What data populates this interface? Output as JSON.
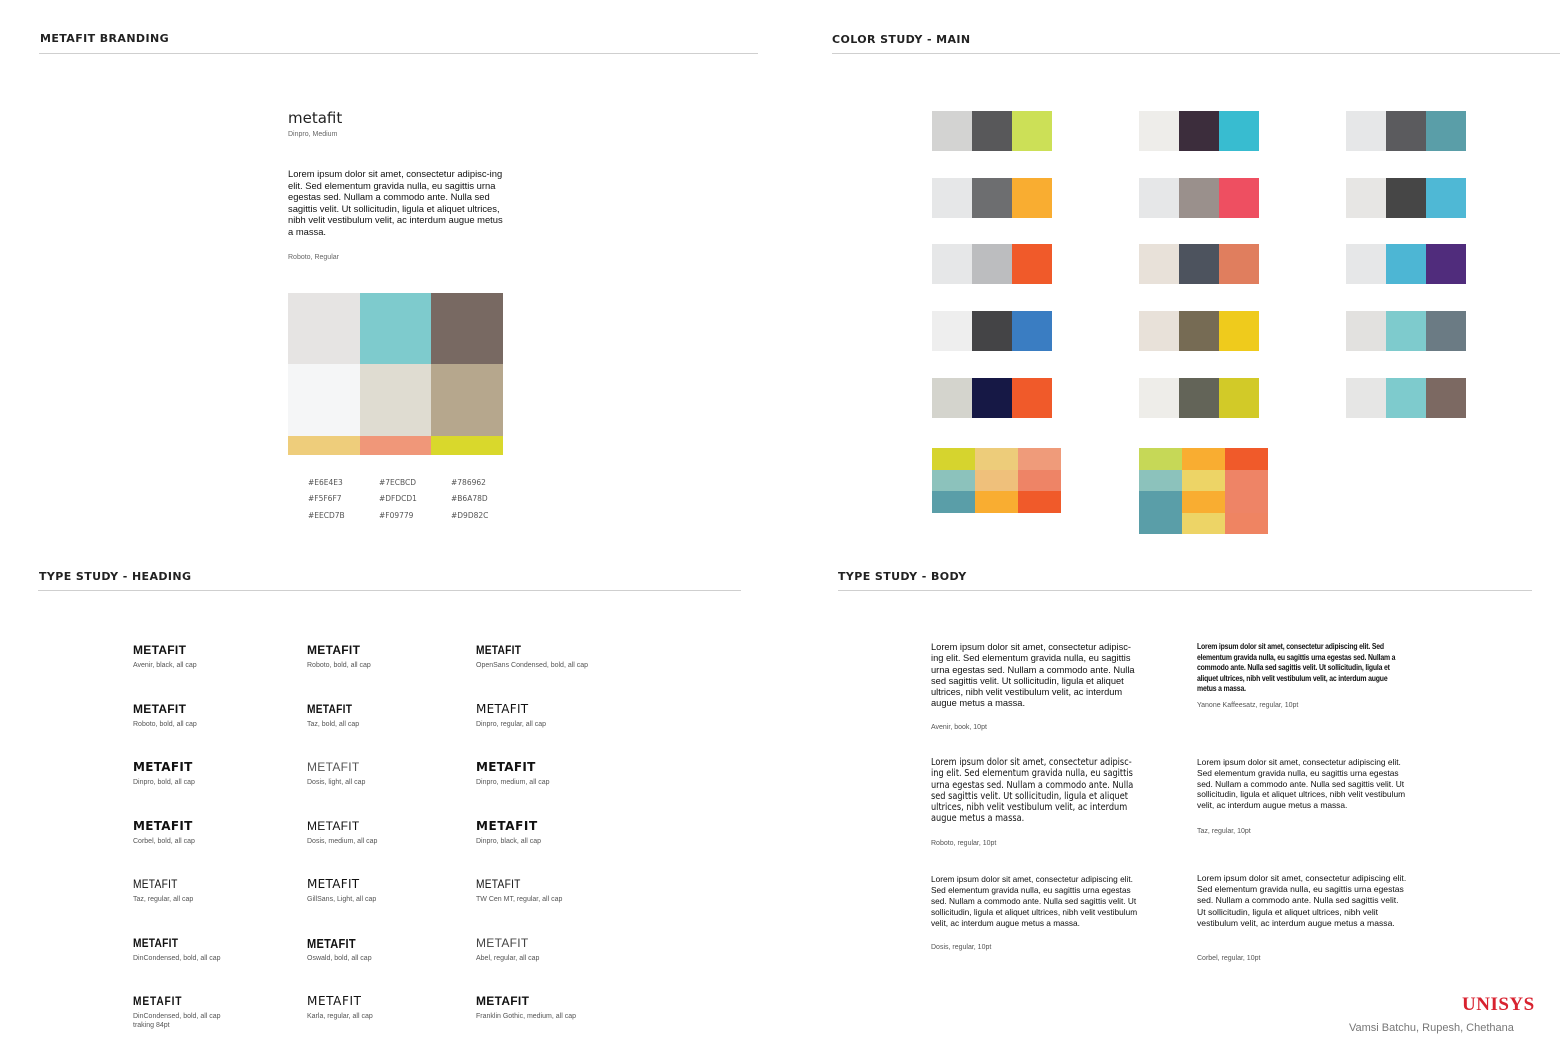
{
  "sections": {
    "branding": "METAFIT BRANDING",
    "color_main": "COLOR STUDY - MAIN",
    "type_heading": "TYPE STUDY - HEADING",
    "type_body": "TYPE STUDY - BODY"
  },
  "branding": {
    "name": "metafit",
    "name_font": "Dinpro, Medium",
    "body": "Lorem ipsum dolor sit amet, consectetur adipisc-ing elit. Sed elementum gravida nulla, eu sagittis urna egestas sed. Nullam a commodo ante. Nulla sed sagittis velit. Ut sollicitudin, ligula et aliquet ultrices, nibh velit vestibulum velit, ac interdum augue metus a massa.",
    "body_font": "Roboto, Regular",
    "swatches": [
      "#E6E4E3",
      "#7ECBCD",
      "#786962",
      "#F5F6F7",
      "#DFDCD1",
      "#B6A78D",
      "#EECD7B",
      "#F09779",
      "#D9D82C"
    ],
    "hex_labels": [
      "#E6E4E3",
      "#7ECBCD",
      "#786962",
      "#F5F6F7",
      "#DFDCD1",
      "#B6A78D",
      "#EECD7B",
      "#F09779",
      "#D9D82C"
    ]
  },
  "palettes": [
    [
      "#d3d3d2",
      "#58585a",
      "#cce057"
    ],
    [
      "#eeedea",
      "#3c2d3c",
      "#38bcd0"
    ],
    [
      "#e6e7e8",
      "#5b5b5e",
      "#5a9ea8"
    ],
    [
      "#e6e7e8",
      "#6d6e70",
      "#f9ad31"
    ],
    [
      "#e6e7e8",
      "#9a908c",
      "#ee4f61"
    ],
    [
      "#e7e6e4",
      "#464646",
      "#4fb8d5"
    ],
    [
      "#e6e7e8",
      "#bcbdbf",
      "#f05a2a"
    ],
    [
      "#e8e1d9",
      "#4d535e",
      "#e07e5e"
    ],
    [
      "#e6e7e8",
      "#4db6d4",
      "#502c7c"
    ],
    [
      "#eeeeee",
      "#444446",
      "#3a7dc2"
    ],
    [
      "#e8e1d9",
      "#766b54",
      "#efcb1c"
    ],
    [
      "#e2e1df",
      "#7ecbcd",
      "#6b7b84"
    ],
    [
      "#d4d4cd",
      "#161845",
      "#f05a2a"
    ],
    [
      "#eeede9",
      "#636458",
      "#d2ca28"
    ],
    [
      "#e6e6e5",
      "#7ecbcd",
      "#7c6962"
    ]
  ],
  "grids": [
    [
      "#d6d42e",
      "#edcc7a",
      "#ef9b7a",
      "#8cc2bc",
      "#efc07b",
      "#ee8466",
      "#5a9ea8",
      "#f9ad31",
      "#f05a2a"
    ],
    [
      "#c6d857",
      "#f9ad31",
      "#f05a2a",
      "#8cc2bc",
      "#edd466",
      "#ee8466",
      "#5a9ea8",
      "#f9ad31",
      "#ee8466",
      "#5a9ea8",
      "#edd466",
      "#ef8462"
    ]
  ],
  "type_heading": [
    {
      "title": "METAFIT",
      "sub": "Avenir, black, all cap"
    },
    {
      "title": "METAFIT",
      "sub": "Roboto, bold, all cap"
    },
    {
      "title": "METAFIT",
      "sub": "OpenSans Condensed, bold, all cap"
    },
    {
      "title": "METAFIT",
      "sub": "Roboto, bold, all cap"
    },
    {
      "title": "METAFIT",
      "sub": "Taz, bold, all cap"
    },
    {
      "title": "METAFIT",
      "sub": "Dinpro, regular, all cap"
    },
    {
      "title": "METAFIT",
      "sub": "Dinpro, bold, all cap"
    },
    {
      "title": "METAFIT",
      "sub": "Dosis, light, all cap"
    },
    {
      "title": "METAFIT",
      "sub": "Dinpro, medium, all cap"
    },
    {
      "title": "METAFIT",
      "sub": "Corbel, bold, all cap"
    },
    {
      "title": "METAFIT",
      "sub": "Dosis, medium, all cap"
    },
    {
      "title": "METAFIT",
      "sub": "Dinpro, black, all cap"
    },
    {
      "title": "METAFIT",
      "sub": "Taz, regular, all cap"
    },
    {
      "title": "METAFIT",
      "sub": "GillSans, Light, all cap"
    },
    {
      "title": "METAFIT",
      "sub": "TW Cen MT, regular, all cap"
    },
    {
      "title": "METAFIT",
      "sub": "DinCondensed, bold, all cap"
    },
    {
      "title": "METAFIT",
      "sub": "Oswald, bold, all cap"
    },
    {
      "title": "METAFIT",
      "sub": "Abel, regular, all cap"
    },
    {
      "title": "METAFIT",
      "sub": "DinCondensed, bold, all cap",
      "sub2": "traking 84pt"
    },
    {
      "title": "METAFIT",
      "sub": "Karla, regular, all cap"
    },
    {
      "title": "METAFIT",
      "sub": "Franklin Gothic, medium, all cap"
    }
  ],
  "type_body": [
    {
      "text": "Lorem ipsum dolor sit amet, consectetur adipisc-ing elit. Sed elementum gravida nulla, eu sagittis urna egestas sed. Nullam a commodo ante. Nulla sed sagittis velit. Ut sollicitudin, ligula et aliquet ultrices, nibh velit vestibulum velit, ac interdum augue metus a massa.",
      "cap": "Avenir, book, 10pt"
    },
    {
      "text": "Lorem ipsum dolor sit amet, consectetur adipiscing elit. Sed elementum gravida nulla, eu sagittis urna egestas sed. Nullam a commodo ante. Nulla sed sagittis velit. Ut sollicitudin, ligula et aliquet ultrices, nibh velit vestibulum velit, ac interdum augue metus a massa.",
      "cap": "Yanone Kaffeesatz, regular, 10pt"
    },
    {
      "text": "Lorem ipsum dolor sit amet, consectetur adipisc-ing elit. Sed elementum gravida nulla, eu sagittis urna egestas sed. Nullam a commodo ante. Nulla sed sagittis velit. Ut sollicitudin, ligula et aliquet ultrices, nibh velit vestibulum velit, ac interdum augue metus a massa.",
      "cap": "Roboto, regular, 10pt"
    },
    {
      "text": "Lorem ipsum dolor sit amet, consectetur adipiscing elit. Sed elementum gravida nulla, eu sagittis urna egestas sed. Nullam a commodo ante. Nulla sed sagittis velit. Ut sollicitudin, ligula et aliquet ultrices, nibh velit vestibulum velit, ac interdum augue metus a massa.",
      "cap": "Taz, regular, 10pt"
    },
    {
      "text": "Lorem ipsum dolor sit amet, consectetur adipiscing elit. Sed elementum gravida nulla, eu sagittis urna egestas sed. Nullam a commodo ante. Nulla sed sagittis velit. Ut sollicitudin, ligula et aliquet ultrices, nibh velit vestibulum velit, ac interdum augue metus a massa.",
      "cap": "Dosis, regular, 10pt"
    },
    {
      "text": "Lorem ipsum dolor sit amet, consectetur adipiscing elit. Sed elementum gravida nulla, eu sagittis urna egestas sed. Nullam a commodo ante. Nulla sed sagittis velit. Ut sollicitudin, ligula et aliquet ultrices, nibh velit vestibulum velit, ac interdum augue metus a massa.",
      "cap": "Corbel, regular, 10pt"
    }
  ],
  "footer": {
    "logo": "UNISYS",
    "credit": "Vamsi Batchu, Rupesh, Chethana"
  }
}
